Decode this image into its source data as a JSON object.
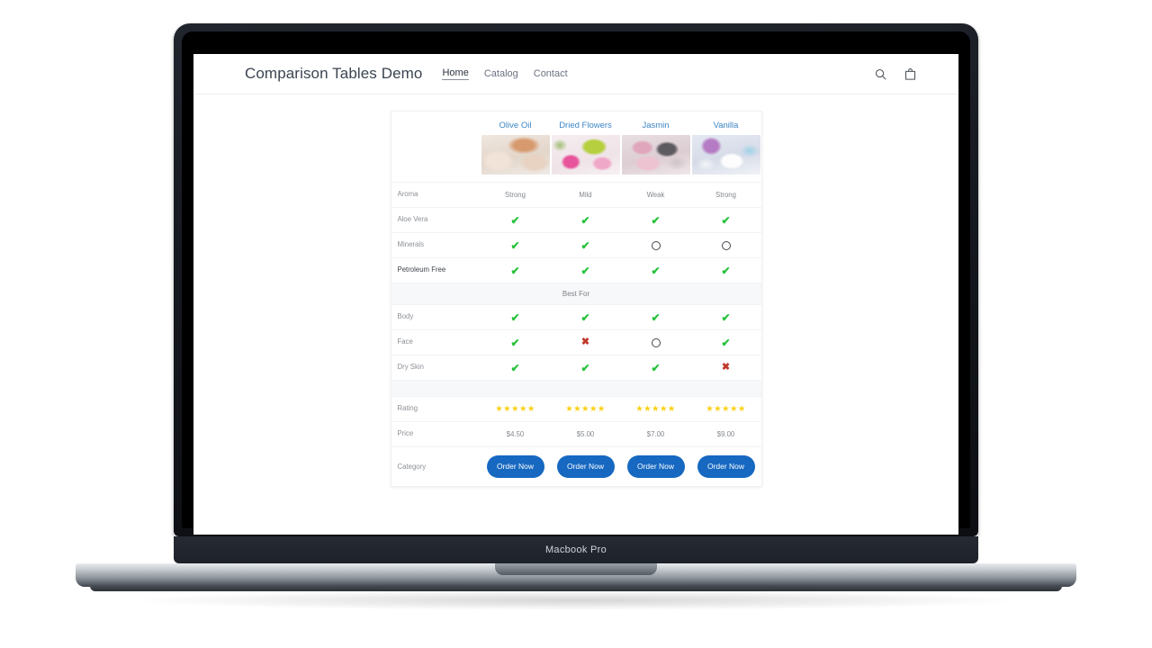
{
  "device": {
    "label": "Macbook Pro"
  },
  "header": {
    "brand": "Comparison Tables Demo",
    "nav": [
      {
        "label": "Home",
        "active": true
      },
      {
        "label": "Catalog",
        "active": false
      },
      {
        "label": "Contact",
        "active": false
      }
    ],
    "icons": {
      "search": "search-icon",
      "cart": "shopping-bag-icon"
    }
  },
  "colors": {
    "link": "#3d85c6",
    "check": "#27c23c",
    "cross": "#c0392b",
    "star": "#fcd116",
    "button": "#1668c1",
    "section_bg": "#f7f8f9"
  },
  "table": {
    "products": [
      {
        "name": "Olive Oil",
        "image": "olive-oil-soap-photo"
      },
      {
        "name": "Dried Flowers",
        "image": "dried-flowers-soap-photo"
      },
      {
        "name": "Jasmin",
        "image": "jasmin-soap-photo"
      },
      {
        "name": "Vanilla",
        "image": "vanilla-soap-photo"
      }
    ],
    "rows": [
      {
        "label": "Aroma",
        "type": "text",
        "values": [
          "Strong",
          "Mild",
          "Weak",
          "Strong"
        ]
      },
      {
        "label": "Aloe Vera",
        "type": "mark",
        "values": [
          "check",
          "check",
          "check",
          "check"
        ]
      },
      {
        "label": "Minerals",
        "type": "mark",
        "values": [
          "check",
          "check",
          "circle",
          "circle"
        ]
      },
      {
        "label": "Petroleum Free",
        "type": "mark",
        "values": [
          "check",
          "check",
          "check",
          "check"
        ]
      }
    ],
    "section_best_for": "Best For",
    "rows_best_for": [
      {
        "label": "Body",
        "type": "mark",
        "values": [
          "check",
          "check",
          "check",
          "check"
        ]
      },
      {
        "label": "Face",
        "type": "mark",
        "values": [
          "check",
          "cross",
          "circle",
          "check"
        ]
      },
      {
        "label": "Dry Skin",
        "type": "mark",
        "values": [
          "check",
          "check",
          "check",
          "cross"
        ]
      }
    ],
    "rating": {
      "label": "Rating",
      "values": [
        5,
        5,
        5,
        5
      ],
      "max": 5
    },
    "price": {
      "label": "Price",
      "values": [
        "$4.50",
        "$5.00",
        "$7.00",
        "$9.00"
      ]
    },
    "cta": {
      "label": "Category",
      "button_label": "Order Now",
      "buttons": [
        "Order Now",
        "Order Now",
        "Order Now",
        "Order Now"
      ]
    }
  }
}
